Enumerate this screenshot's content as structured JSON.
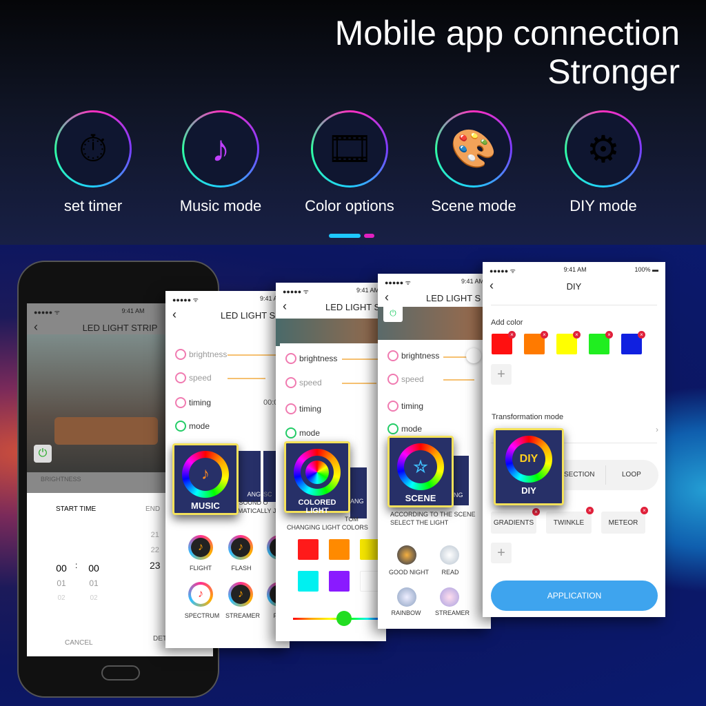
{
  "headline": {
    "line1": "Mobile app connection",
    "line2": "Stronger"
  },
  "features": [
    {
      "label": "set timer",
      "icon": "stopwatch-icon"
    },
    {
      "label": "Music mode",
      "icon": "music-note-icon"
    },
    {
      "label": "Color options",
      "icon": "film-strip-icon"
    },
    {
      "label": "Scene mode",
      "icon": "palette-icon"
    },
    {
      "label": "DIY mode",
      "icon": "head-gears-icon"
    }
  ],
  "colors": {
    "accent_cyan": "#1ec8ff",
    "accent_magenta": "#e020c0",
    "card_border": "#f3e15a",
    "card_bg": "#273068",
    "apply_button": "#3ea4ee"
  },
  "status": {
    "time": "9:41 AM",
    "battery": "100%"
  },
  "phone": {
    "title": "LED LIGHT STRIP",
    "brightness_label": "BRIGHTNESS",
    "start_time": "START TIME",
    "end_time": "END",
    "hours": [
      "00",
      "01",
      "02"
    ],
    "minutes": [
      "00",
      "01",
      "02"
    ],
    "end_hours": [
      "21",
      "22",
      "23"
    ],
    "separator": ":",
    "cancel": "CANCEL",
    "determine": "DETE"
  },
  "panel_common": {
    "title": "LED LIGHT S",
    "brightness": "brightness",
    "speed": "speed",
    "timing": "timing",
    "mode": "mode",
    "timing_value": "00:0"
  },
  "music_panel": {
    "card": "MUSIC",
    "behind1": "ANG",
    "behind2": "SC",
    "desc1": "E SOUND O",
    "desc2": "AUTOMATICALLY JUM",
    "modes": [
      "FLIGHT",
      "FLASH",
      "FL",
      "SPECTRUM",
      "STREAMER",
      "PO"
    ]
  },
  "color_panel": {
    "card": "COLORED LIGHT",
    "behind": "ANG",
    "desc1": "TOM",
    "desc2": "CHANGING LIGHT COLORS",
    "swatches": [
      "#ff1a1a",
      "#ff8a00",
      "#f5e600",
      "#00f0f0",
      "#8a1aff",
      "#ffffff"
    ],
    "hue_slider": 0.55
  },
  "scene_panel": {
    "card": "SCENE",
    "behind": "NG",
    "desc1": "ACCORDING TO THE SCENE",
    "desc2": "SELECT THE LIGHT",
    "scenes": [
      "GOOD NIGHT",
      "READ",
      "RAINBOW",
      "STREAMER"
    ]
  },
  "diy_panel": {
    "title": "DIY",
    "add_color": "Add color",
    "colors": [
      "#ff1010",
      "#ff7a00",
      "#ffff00",
      "#20ee20",
      "#1020e0"
    ],
    "transformation": "Transformation mode",
    "segments": [
      "SECTION",
      "LOOP"
    ],
    "effects": [
      "GRADIENTS",
      "TWINKLE",
      "METEOR"
    ],
    "card": "DIY",
    "apply": "APPLICATION",
    "plus": "+",
    "chevron": "›"
  }
}
